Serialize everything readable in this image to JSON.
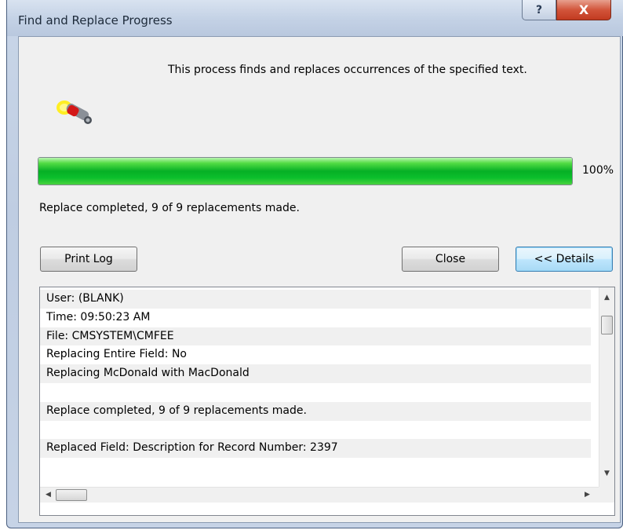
{
  "window": {
    "title": "Find and Replace Progress",
    "help_label": "?",
    "close_label": "X"
  },
  "description": "This process finds and replaces occurrences of the specified text.",
  "progress": {
    "value": 1.0,
    "percent_label": "100%",
    "fill_color": "#06b025"
  },
  "status": "Replace completed, 9 of 9 replacements made.",
  "buttons": {
    "print_log": "Print Log",
    "close": "Close",
    "details": "<< Details"
  },
  "icons": {
    "app": "find-replace-wand-icon",
    "scroll_up": "▲",
    "scroll_down": "▼",
    "scroll_left": "◀",
    "scroll_right": "▶"
  },
  "log": {
    "lines": [
      "User: (BLANK)",
      "Time: 09:50:23 AM",
      "File: CMSYSTEM\\CMFEE",
      "Replacing Entire Field: No",
      "Replacing McDonald with MacDonald",
      "",
      "Replace completed, 9 of 9 replacements made.",
      "",
      "Replaced Field: Description for Record Number: 2397"
    ]
  }
}
